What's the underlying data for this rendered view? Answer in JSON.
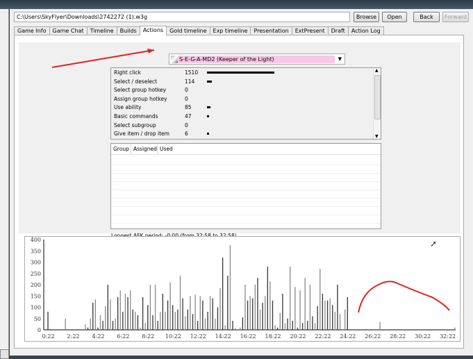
{
  "file_path": "C:\\Users\\SkyFlyer\\Downloads\\2742272 (1).w3g",
  "buttons": {
    "browse": "Browse",
    "open": "Open",
    "back": "Back",
    "forward": "Forward"
  },
  "tabs": [
    "Game Info",
    "Game Chat",
    "Timeline",
    "Builds",
    "Actions",
    "Gold timeline",
    "Exp timeline",
    "Presentation",
    "ExtPresent",
    "Draft",
    "Action Log"
  ],
  "active_tab": "Actions",
  "player_select": "S-E-G-A-MD2 (Keeper of the Light)",
  "actions": [
    {
      "label": "Right click",
      "value": 1510
    },
    {
      "label": "Select / deselect",
      "value": 114
    },
    {
      "label": "Select group hotkey",
      "value": 0
    },
    {
      "label": "Assign group hotkey",
      "value": 0
    },
    {
      "label": "Use ability",
      "value": 85
    },
    {
      "label": "Basic commands",
      "value": 47
    },
    {
      "label": "Select subgroup",
      "value": 0
    },
    {
      "label": "Give item / drop item",
      "value": 6
    }
  ],
  "group_table": {
    "columns": [
      "Group",
      "Assigned",
      "Used"
    ],
    "rows": []
  },
  "afk_text": "Longest AFK period: -0:00 (from 32:58 to 32:58)",
  "chart_data": {
    "type": "bar",
    "title": "",
    "ylim": [
      0,
      400
    ],
    "y_ticks": [
      0,
      50,
      100,
      150,
      200,
      250,
      300,
      350,
      400
    ],
    "x_ticks": [
      "0:22",
      "2:22",
      "4:22",
      "6:22",
      "8:22",
      "10:22",
      "12:22",
      "14:22",
      "16:22",
      "18:22",
      "20:22",
      "22:22",
      "24:22",
      "26:22",
      "28:22",
      "30:22",
      "32:22"
    ],
    "x_range_seconds": [
      0,
      1980
    ],
    "bin_seconds": 12,
    "values": [
      0,
      80,
      0,
      0,
      0,
      0,
      0,
      0,
      50,
      0,
      0,
      0,
      0,
      0,
      0,
      0,
      25,
      10,
      50,
      120,
      135,
      10,
      65,
      40,
      105,
      200,
      135,
      40,
      50,
      145,
      175,
      80,
      160,
      145,
      175,
      90,
      80,
      65,
      10,
      145,
      30,
      110,
      200,
      65,
      200,
      40,
      80,
      160,
      80,
      130,
      210,
      110,
      80,
      90,
      240,
      140,
      60,
      90,
      150,
      70,
      155,
      40,
      150,
      130,
      50,
      80,
      150,
      140,
      50,
      100,
      185,
      320,
      20,
      240,
      375,
      40,
      10,
      0,
      10,
      55,
      200,
      130,
      150,
      140,
      200,
      230,
      90,
      120,
      150,
      280,
      215,
      130,
      20,
      10,
      75,
      160,
      30,
      50,
      280,
      40,
      190,
      10,
      175,
      30,
      230,
      40,
      200,
      60,
      30,
      105,
      270,
      160,
      130,
      130,
      140,
      110,
      80,
      200,
      70,
      0,
      90,
      145,
      0,
      0,
      0,
      0,
      0,
      0,
      0,
      0,
      0,
      0,
      0,
      0,
      35,
      0,
      0,
      0,
      0,
      0,
      0,
      0,
      0,
      0,
      0,
      0,
      0,
      0,
      0,
      0,
      0,
      0,
      0,
      0,
      0,
      0,
      0,
      0,
      0,
      0,
      0,
      0,
      0,
      0,
      10
    ],
    "bar_color": "#555555"
  }
}
